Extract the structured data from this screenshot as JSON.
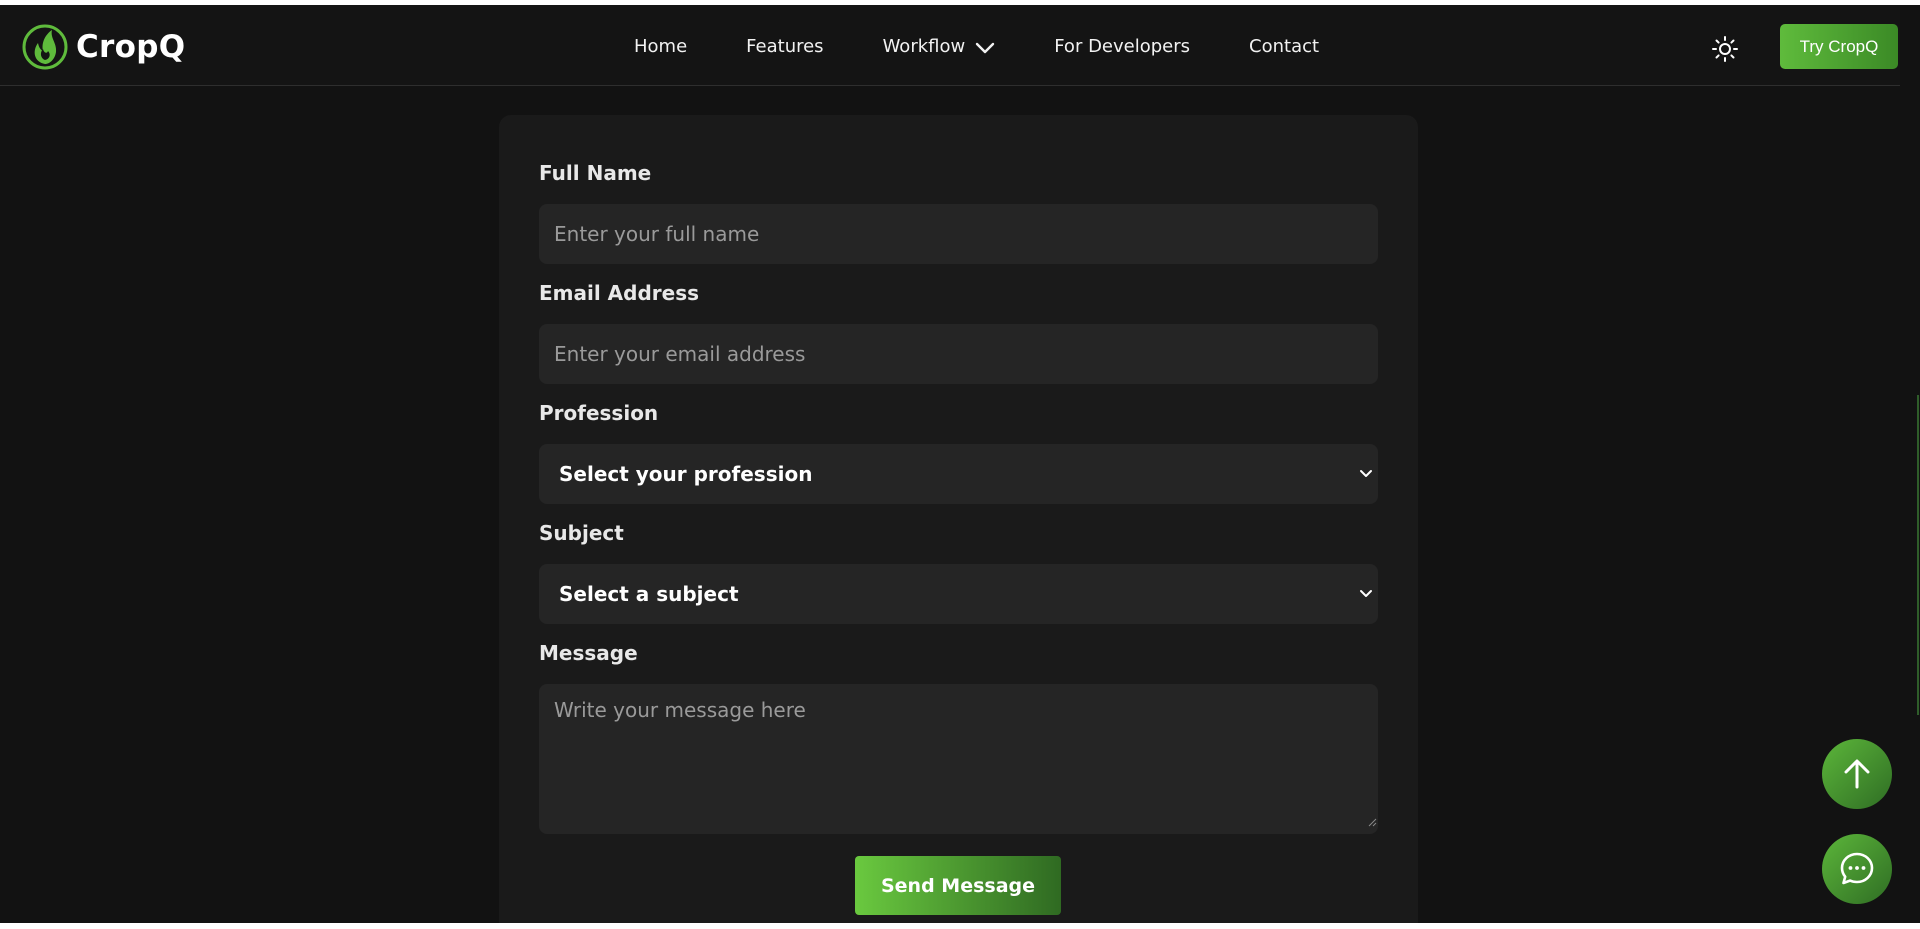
{
  "brand": {
    "name": "CropQ",
    "logo_icon": "flame-leaf-logo-icon",
    "accent": "#5fbb3c"
  },
  "nav": {
    "links": [
      {
        "label": "Home"
      },
      {
        "label": "Features"
      },
      {
        "label": "Workflow",
        "has_dropdown": true
      },
      {
        "label": "For Developers"
      },
      {
        "label": "Contact"
      }
    ],
    "theme_icon": "sun-icon",
    "cta_label": "Try CropQ"
  },
  "form": {
    "full_name": {
      "label": "Full Name",
      "placeholder": "Enter your full name",
      "value": ""
    },
    "email": {
      "label": "Email Address",
      "placeholder": "Enter your email address",
      "value": ""
    },
    "profession": {
      "label": "Profession",
      "selected": "Select your profession"
    },
    "subject": {
      "label": "Subject",
      "selected": "Select a subject"
    },
    "message": {
      "label": "Message",
      "placeholder": "Write your message here",
      "value": ""
    },
    "submit_label": "Send Message"
  },
  "floating": {
    "scroll_top_icon": "arrow-up-icon",
    "chat_icon": "chat-bubble-icon"
  }
}
